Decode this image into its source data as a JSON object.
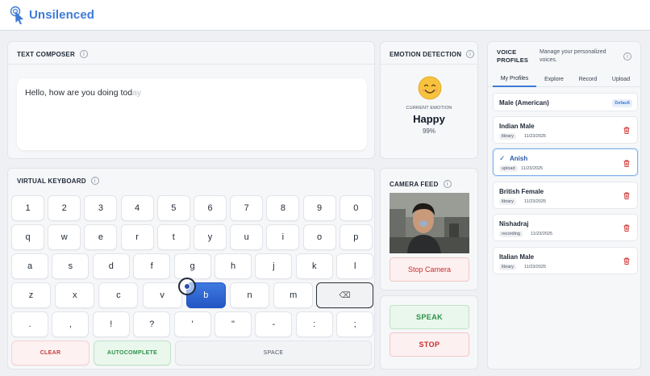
{
  "app": {
    "title": "Unsilenced"
  },
  "composer": {
    "title": "TEXT COMPOSER",
    "typed_text": "Hello, how are you doing tod",
    "suggestion_text": "ay"
  },
  "emotion": {
    "title": "EMOTION DETECTION",
    "caption": "CURRENT EMOTION",
    "value": "Happy",
    "confidence": "99%"
  },
  "keyboard": {
    "title": "VIRTUAL KEYBOARD",
    "row1": [
      "1",
      "2",
      "3",
      "4",
      "5",
      "6",
      "7",
      "8",
      "9",
      "0"
    ],
    "row2": [
      "q",
      "w",
      "e",
      "r",
      "t",
      "y",
      "u",
      "i",
      "o",
      "p"
    ],
    "row3": [
      "a",
      "s",
      "d",
      "f",
      "g",
      "h",
      "j",
      "k",
      "l"
    ],
    "row4": [
      "z",
      "x",
      "c",
      "v",
      "b",
      "n",
      "m",
      "⌫"
    ],
    "row5": [
      ".",
      ",",
      "!",
      "?",
      "'",
      "\"",
      "-",
      ":",
      ";"
    ],
    "active_key": "b",
    "clear_label": "CLEAR",
    "autocomplete_label": "AUTOCOMPLETE",
    "space_label": "SPACE"
  },
  "camera": {
    "title": "CAMERA FEED",
    "stop_label": "Stop Camera"
  },
  "speech": {
    "speak_label": "SPEAK",
    "stop_label": "STOP"
  },
  "voice": {
    "title": "VOICE PROFILES",
    "subtitle": "Manage your personalized voices.",
    "tabs": [
      "My Profiles",
      "Explore",
      "Record",
      "Upload"
    ],
    "active_tab": "My Profiles",
    "profiles": [
      {
        "name": "Male (American)",
        "badge": "Default"
      },
      {
        "name": "Indian Male",
        "tag": "library",
        "date": "11/23/2025"
      },
      {
        "name": "Anish",
        "tag": "upload",
        "date": "11/23/2025",
        "selected": true
      },
      {
        "name": "British Female",
        "tag": "library",
        "date": "11/23/2025"
      },
      {
        "name": "Nishadraj",
        "tag": "recording",
        "date": "11/23/2025"
      },
      {
        "name": "Italian Male",
        "tag": "library",
        "date": "11/23/2025"
      }
    ]
  },
  "colors": {
    "brand": "#3d7bd6",
    "active_key": "#2456c4",
    "danger": "#c62f2f",
    "success": "#2e9048"
  }
}
